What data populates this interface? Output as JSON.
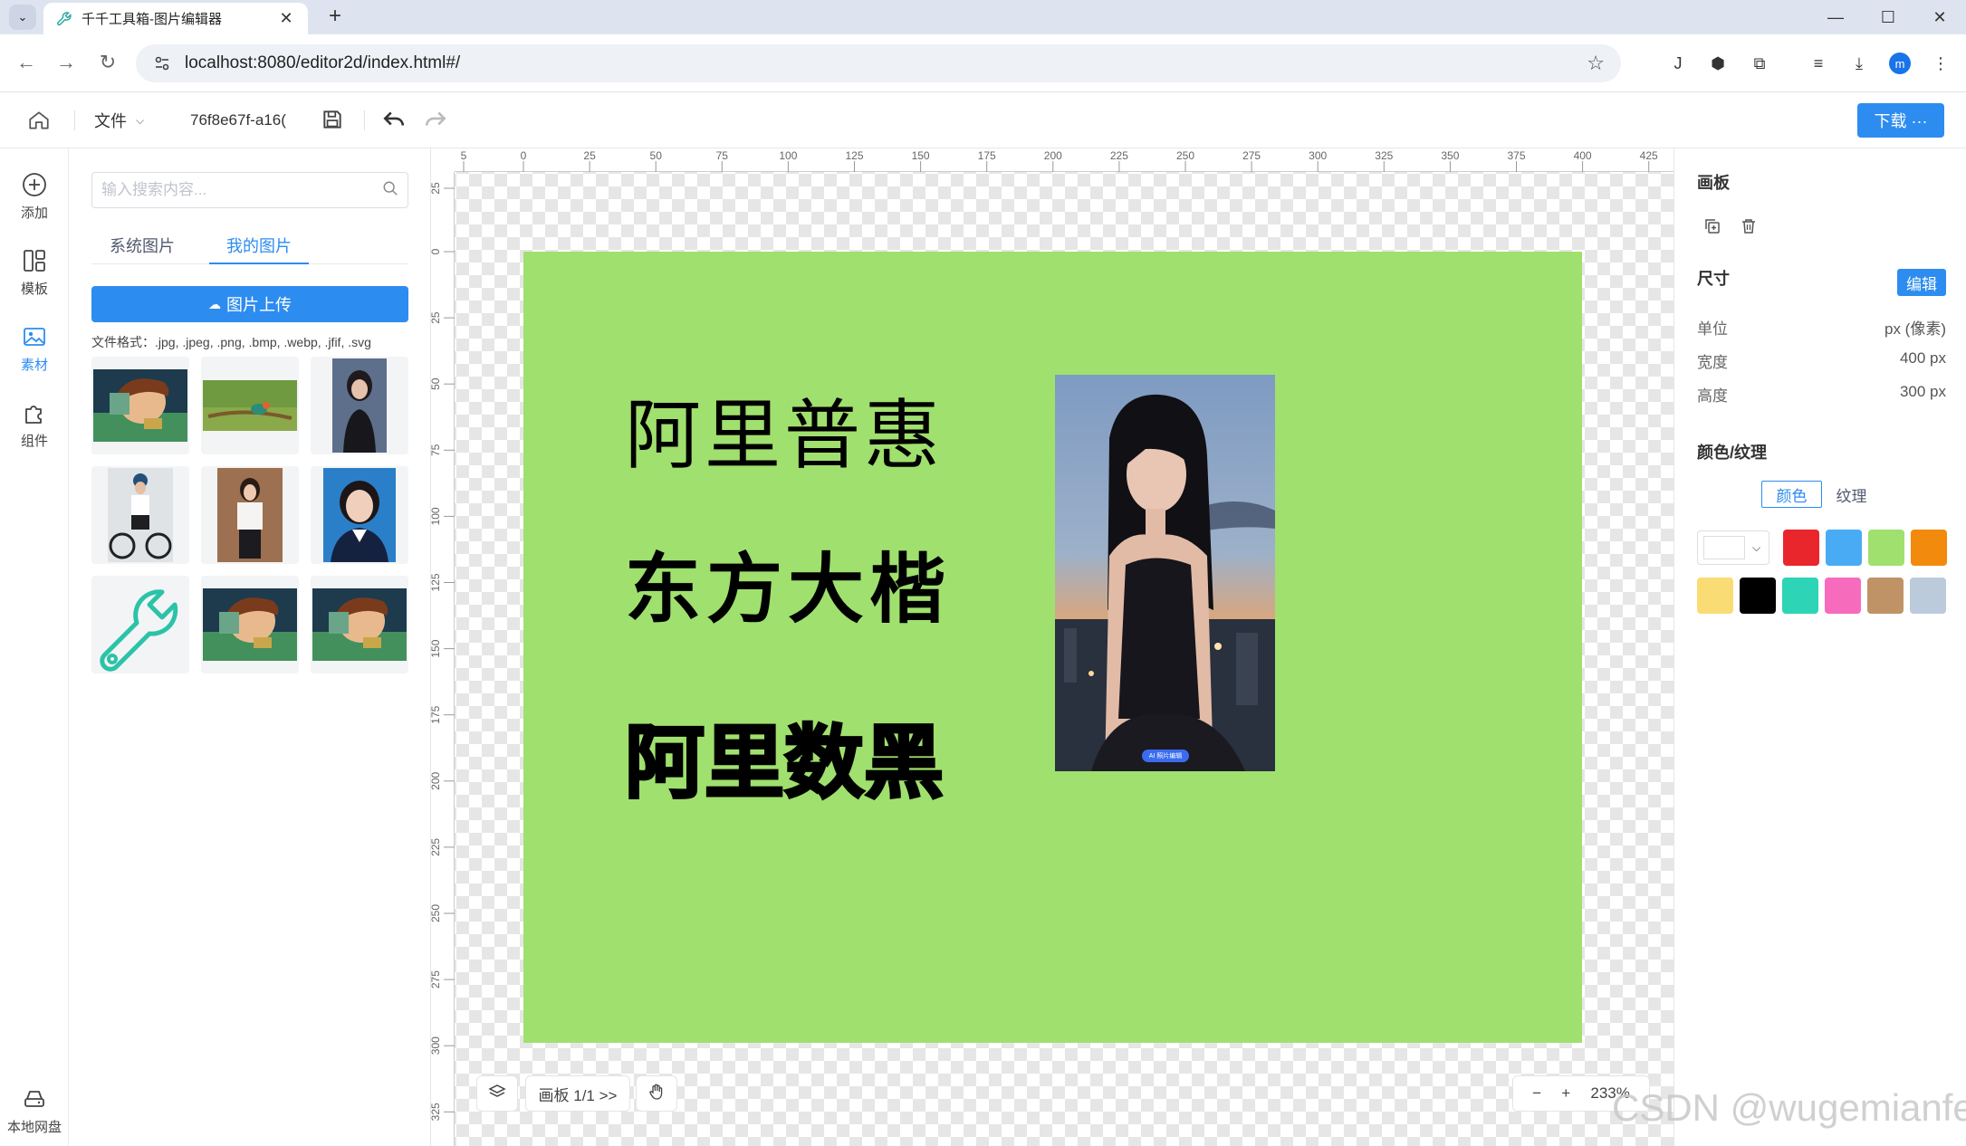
{
  "browser": {
    "tab_title": "千千工具箱-图片编辑器",
    "url": "localhost:8080/editor2d/index.html#/",
    "profile_initial": "m",
    "new_tab_symbol": "+",
    "close_tab_symbol": "✕"
  },
  "app": {
    "file_menu_label": "文件",
    "doc_name": "76f8e67f-a16(",
    "download_label": "下载 ···"
  },
  "rail": [
    {
      "label": "添加",
      "icon": "plus-circle-icon"
    },
    {
      "label": "模板",
      "icon": "template-icon"
    },
    {
      "label": "素材",
      "icon": "image-icon"
    },
    {
      "label": "组件",
      "icon": "puzzle-icon"
    }
  ],
  "rail_bottom_label": "本地网盘",
  "materials": {
    "search_placeholder": "输入搜索内容...",
    "tabs": [
      "系统图片",
      "我的图片"
    ],
    "active_tab": "我的图片",
    "upload_label": "图片上传",
    "formats_text": "文件格式：.jpg, .jpeg, .png, .bmp, .webp, .jfif, .svg",
    "thumbnails": [
      "anime-boy",
      "bird-on-branch",
      "woman-portrait",
      "cyclist-woman",
      "woman-in-cafe",
      "student-portrait",
      "wrench-icon",
      "anime-boy",
      "anime-boy"
    ]
  },
  "rulers": {
    "h_ticks": [
      "5",
      "0",
      "25",
      "50",
      "75",
      "100",
      "125",
      "150",
      "175",
      "200",
      "225",
      "250",
      "275",
      "300",
      "325",
      "350",
      "375",
      "400",
      "425"
    ],
    "v_ticks": [
      "25",
      "0",
      "25",
      "50",
      "75",
      "100",
      "125",
      "150",
      "175",
      "200",
      "225",
      "250",
      "275",
      "300",
      "325"
    ]
  },
  "artboard": {
    "background_color": "#a0e06e",
    "texts": [
      "阿里普惠",
      "东方大楷",
      "阿里数黑"
    ],
    "photo_badge": "AI 照片编辑"
  },
  "canvas_controls": {
    "page_indicator": "画板 1/1 >>",
    "zoom_out": "−",
    "zoom_in": "+",
    "zoom": "233%"
  },
  "properties": {
    "panel_title": "画板",
    "size_title": "尺寸",
    "edit_label": "编辑",
    "rows": [
      {
        "label": "单位",
        "value": "px (像素)"
      },
      {
        "label": "宽度",
        "value": "400 px"
      },
      {
        "label": "高度",
        "value": "300 px"
      }
    ],
    "color_title": "颜色/纹理",
    "color_tabs": [
      "颜色",
      "纹理"
    ],
    "swatches": [
      "#e8262b",
      "#4aabf5",
      "#a0e06e",
      "#f28a0e",
      "#f9dc74",
      "#000000",
      "#2dd4b6",
      "#f76bbd",
      "#c09366",
      "#bccbdc"
    ]
  },
  "watermark": "CSDN @wugemianfei"
}
